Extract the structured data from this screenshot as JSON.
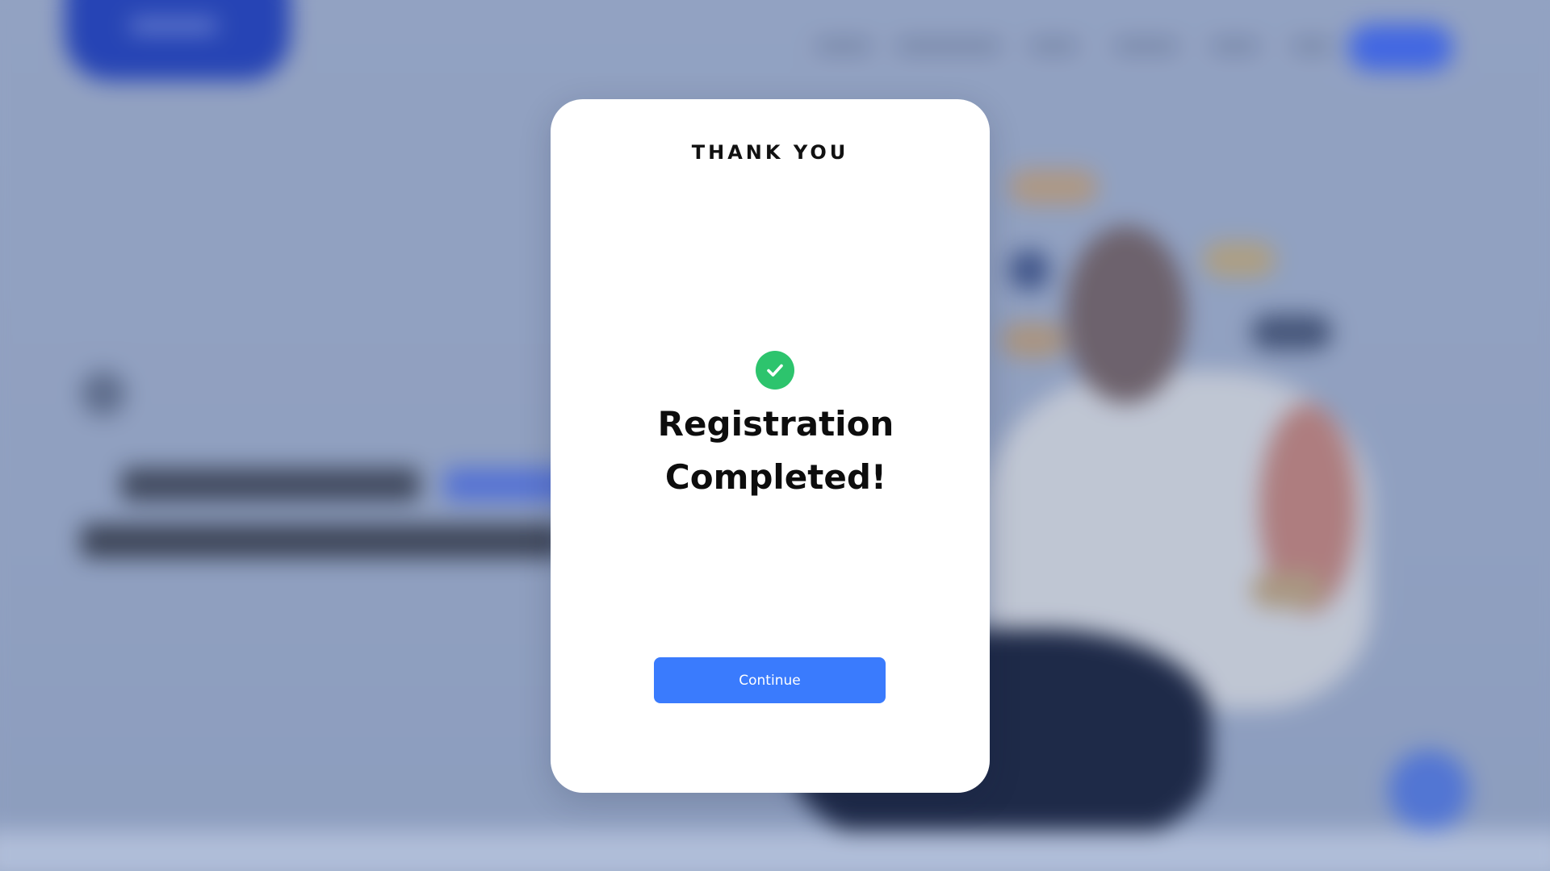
{
  "modal": {
    "heading": "THANK YOU",
    "icon": "check-circle-icon",
    "title": "Registration Completed!",
    "button_label": "Continue"
  },
  "colors": {
    "success": "#2dc46d",
    "primary_button": "#3a7bfd",
    "background_overlay": "#95a4c2"
  }
}
